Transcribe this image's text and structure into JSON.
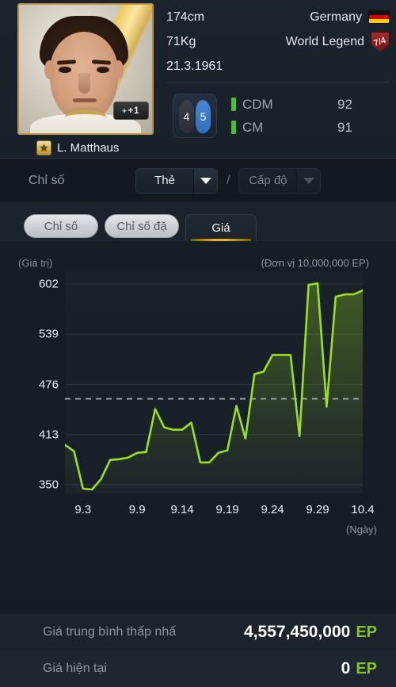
{
  "player": {
    "name": "L. Matthaus",
    "enhance_badge": "+1",
    "height": "174cm",
    "weight": "71Kg",
    "birthdate": "21.3.1961",
    "nation": "Germany",
    "class": "World Legend",
    "nation_icon": "germany-flag-icon",
    "class_icon": "world-legend-crest-icon",
    "star_icon": "star-icon",
    "foot_left": "4",
    "foot_right": "5",
    "positions": [
      {
        "name": "CDM",
        "value": "92"
      },
      {
        "name": "CM",
        "value": "91"
      }
    ]
  },
  "filterbar": {
    "label": "Chỉ số",
    "primary_select": {
      "value": "Thẻ",
      "icon": "chevron-down-icon"
    },
    "separator": "/",
    "secondary_select": {
      "value": "Cấp độ",
      "icon": "chevron-down-icon"
    }
  },
  "tabs": [
    {
      "label": "Chỉ số",
      "active": false
    },
    {
      "label": "Chỉ số đặ",
      "active": false
    },
    {
      "label": "Giá",
      "active": true
    }
  ],
  "footer": [
    {
      "label": "Giá trung bình thấp nhấ",
      "value": "4,557,450,000",
      "unit": "EP"
    },
    {
      "label": "Giá hiện tại",
      "value": "0",
      "unit": "EP"
    }
  ],
  "colors": {
    "line": "#9ede1a",
    "accent": "#86c520",
    "tab_underline": "#e8b317",
    "background": "#151d25"
  },
  "chart_data": {
    "type": "line",
    "title": "",
    "ylabel": "(Giá trị)",
    "xlabel": "(Ngày)",
    "unit_note": "(Đơn vị 10,000,000 EP)",
    "ylim": [
      339,
      618
    ],
    "yticks": [
      350,
      413,
      476,
      539,
      602
    ],
    "xticks": [
      "9.3",
      "9.9",
      "9.14",
      "9.19",
      "9.24",
      "9.29",
      "10.4"
    ],
    "grid": true,
    "average_line": {
      "value": 458,
      "style": "dashed",
      "color": "#8d99a4"
    },
    "x": [
      "9.1",
      "9.2",
      "9.3",
      "9.4",
      "9.5",
      "9.6",
      "9.7",
      "9.8",
      "9.9",
      "9.10",
      "9.11",
      "9.12",
      "9.13",
      "9.14",
      "9.15",
      "9.16",
      "9.17",
      "9.18",
      "9.19",
      "9.20",
      "9.21",
      "9.22",
      "9.23",
      "9.24",
      "9.25",
      "9.26",
      "9.27",
      "9.28",
      "9.29",
      "9.30",
      "10.1",
      "10.2",
      "10.3",
      "10.4"
    ],
    "values": [
      400,
      392,
      345,
      344,
      357,
      381,
      382,
      384,
      390,
      391,
      445,
      422,
      419,
      419,
      428,
      378,
      378,
      390,
      393,
      449,
      408,
      489,
      492,
      513,
      513,
      513,
      411,
      601,
      603,
      448,
      586,
      589,
      589,
      594
    ]
  }
}
